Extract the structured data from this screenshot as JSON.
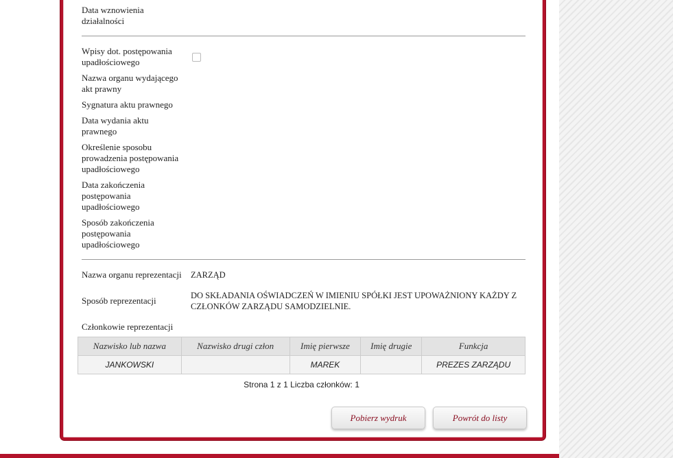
{
  "fields": {
    "resume_date_label": "Data wznowienia działalności",
    "bankruptcy_entries_label": "Wpisy dot. postępowania upadłościowego",
    "issuing_body_label": "Nazwa organu wydającego akt prawny",
    "act_signature_label": "Sygnatura aktu prawnego",
    "act_date_label": "Data wydania aktu prawnego",
    "procedure_method_label": "Określenie sposobu prowadzenia postępowania upadłościowego",
    "procedure_end_date_label": "Data zakończenia postępowania upadłościowego",
    "procedure_end_method_label": "Sposób zakończenia postępowania upadłościowego"
  },
  "representation": {
    "body_name_label": "Nazwa organu reprezentacji",
    "body_name_value": "ZARZĄD",
    "method_label": "Sposób reprezentacji",
    "method_value": "DO SKŁADANIA OŚWIADCZEŃ W IMIENIU SPÓŁKI JEST UPOWAŻNIONY KAŻDY Z CZŁONKÓW ZARZĄDU SAMODZIELNIE.",
    "members_label": "Członkowie reprezentacji"
  },
  "members_table": {
    "columns": [
      "Nazwisko lub nazwa",
      "Nazwisko drugi człon",
      "Imię pierwsze",
      "Imię drugie",
      "Funkcja"
    ],
    "rows": [
      [
        "JANKOWSKI",
        "",
        "MAREK",
        "",
        "PREZES ZARZĄDU"
      ]
    ]
  },
  "pager": {
    "text": "Strona 1 z 1 Liczba członków: 1"
  },
  "buttons": {
    "download_label": "Pobierz wydruk",
    "back_label": "Powrót do listy"
  },
  "colors": {
    "accent": "#b3122a",
    "button_text": "#8b0f22"
  }
}
